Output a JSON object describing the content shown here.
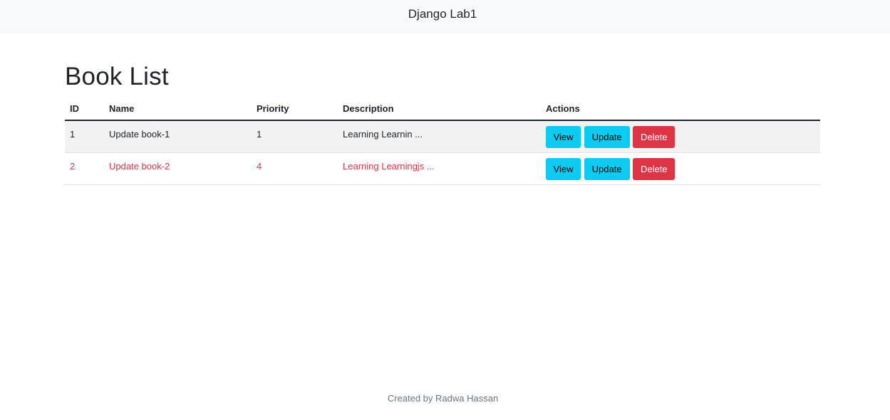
{
  "navbar": {
    "brand": "Django Lab1"
  },
  "page": {
    "title": "Book List"
  },
  "table": {
    "headers": {
      "id": "ID",
      "name": "Name",
      "priority": "Priority",
      "description": "Description",
      "actions": "Actions"
    },
    "rows": [
      {
        "id": "1",
        "name": "Update book-1",
        "priority": "1",
        "description": "Learning Learnin ...",
        "style": "default"
      },
      {
        "id": "2",
        "name": "Update book-2",
        "priority": "4",
        "description": "Learning Learningjs ...",
        "style": "danger"
      }
    ],
    "actions": {
      "view": "View",
      "update": "Update",
      "delete": "Delete"
    }
  },
  "footer": {
    "text": "Created by Radwa Hassan"
  },
  "colors": {
    "info": "#0dcaf0",
    "danger": "#dc3545",
    "navbar_bg": "#f8f9fa",
    "stripe": "#f2f2f2"
  }
}
